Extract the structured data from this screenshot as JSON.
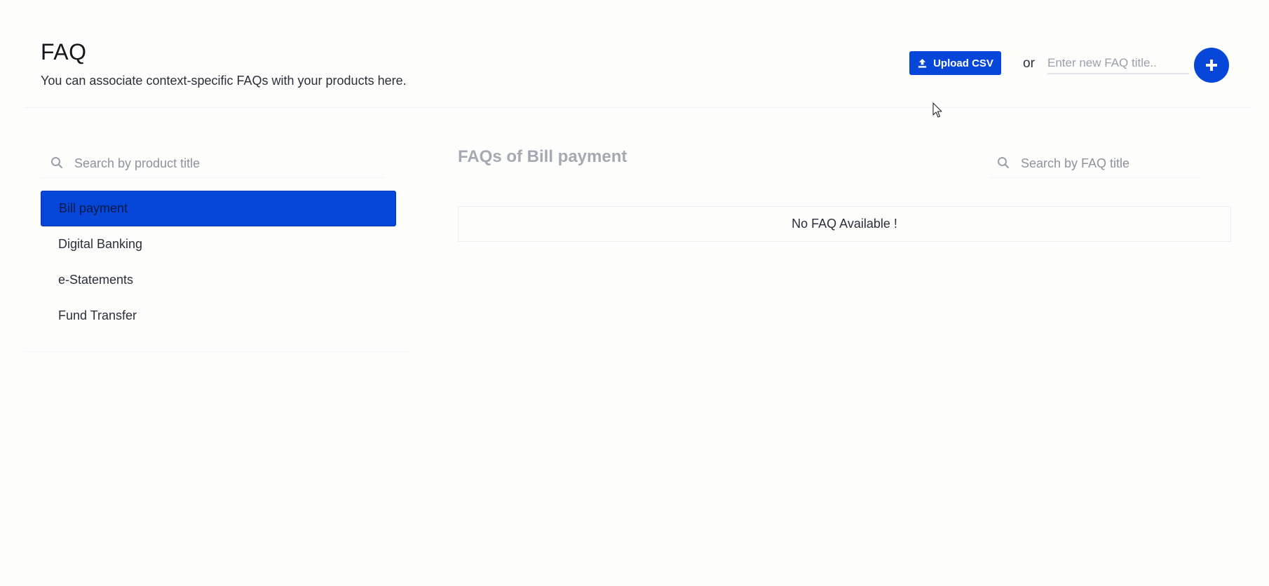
{
  "header": {
    "title": "FAQ",
    "subtitle": "You can associate context-specific FAQs with your products here.",
    "upload_label": "Upload CSV",
    "or_text": "or",
    "new_faq_placeholder": "Enter new FAQ title..",
    "add_icon": "plus-icon"
  },
  "products": {
    "search_placeholder": "Search by product title",
    "items": [
      {
        "label": "Bill payment",
        "active": true
      },
      {
        "label": "Digital Banking",
        "active": false
      },
      {
        "label": "e-Statements",
        "active": false
      },
      {
        "label": "Fund Transfer",
        "active": false
      }
    ]
  },
  "faqs": {
    "heading": "FAQs of Bill payment",
    "search_placeholder": "Search by FAQ title",
    "empty_message": "No FAQ Available !"
  },
  "colors": {
    "accent": "#0646d8",
    "muted_heading": "#a4a9b2"
  }
}
